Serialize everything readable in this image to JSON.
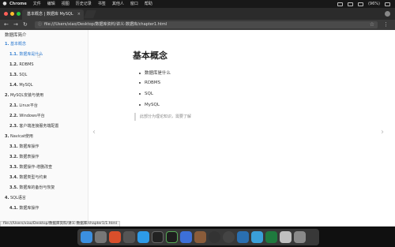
{
  "menubar": {
    "apple": "",
    "app": "Chrome",
    "items": [
      "文件",
      "编辑",
      "视图",
      "历史记录",
      "书签",
      "其他人",
      "窗口",
      "帮助"
    ],
    "battery": "(96%)"
  },
  "tab": {
    "title": "基本概念 | 数据库 MySQL"
  },
  "toolbar": {
    "back_icon": "back-arrow-icon",
    "forward_icon": "forward-arrow-icon",
    "reload_icon": "reload-icon",
    "url": "file:///Users/xiao/Desktop/数据库资料/讲义-数据库/chapter1.html"
  },
  "sidebar": {
    "title": "数据库简介",
    "items": [
      {
        "num": "1.",
        "label": " 基本概念",
        "level": 1,
        "active": true
      },
      {
        "num": "1.1.",
        "label": " 数据库是什么",
        "level": 2,
        "active": true
      },
      {
        "num": "1.2.",
        "label": " RDBMS",
        "level": 2,
        "active": false
      },
      {
        "num": "1.3.",
        "label": " SQL",
        "level": 2,
        "active": false
      },
      {
        "num": "1.4.",
        "label": " MySQL",
        "level": 2,
        "active": false
      },
      {
        "num": "2.",
        "label": " MySQL安装与使用",
        "level": 1,
        "active": false
      },
      {
        "num": "2.1.",
        "label": " Linux平台",
        "level": 2,
        "active": false
      },
      {
        "num": "2.2.",
        "label": " Windows平台",
        "level": 2,
        "active": false
      },
      {
        "num": "2.3.",
        "label": " 客户端连接服务端配置",
        "level": 2,
        "active": false
      },
      {
        "num": "3.",
        "label": " Navicat使用",
        "level": 1,
        "active": false
      },
      {
        "num": "3.1.",
        "label": " 数据库操作",
        "level": 2,
        "active": false
      },
      {
        "num": "3.2.",
        "label": " 数据表操作",
        "level": 2,
        "active": false
      },
      {
        "num": "3.3.",
        "label": " 数据操作-增删改查",
        "level": 2,
        "active": false
      },
      {
        "num": "3.4.",
        "label": " 数据类型与约束",
        "level": 2,
        "active": false
      },
      {
        "num": "3.5.",
        "label": " 数据库的备份与恢复",
        "level": 2,
        "active": false
      },
      {
        "num": "4.",
        "label": " SQL语言",
        "level": 1,
        "active": false
      },
      {
        "num": "4.1.",
        "label": " 数据库操作",
        "level": 2,
        "active": false
      }
    ]
  },
  "content": {
    "title": "基本概念",
    "items": [
      "数据库是什么",
      "RDBMS",
      "SQL",
      "MySQL"
    ],
    "note": "此部分为理论知识，需要了解"
  },
  "status_url": "file:///Users/xiao/Desktop/数据库资料/讲义-数据库/chapter1/1.html",
  "dock": {
    "icons": [
      "finder-icon",
      "launchpad-icon",
      "chrome-icon",
      "rocket-icon",
      "safari-icon",
      "terminal-icon",
      "pycharm-icon",
      "folder-icon",
      "app-icon",
      "obs-icon",
      "obs2-icon",
      "virtualbox-icon",
      "navicat-icon",
      "excel-icon",
      "preview-icon",
      "trash-icon"
    ]
  }
}
